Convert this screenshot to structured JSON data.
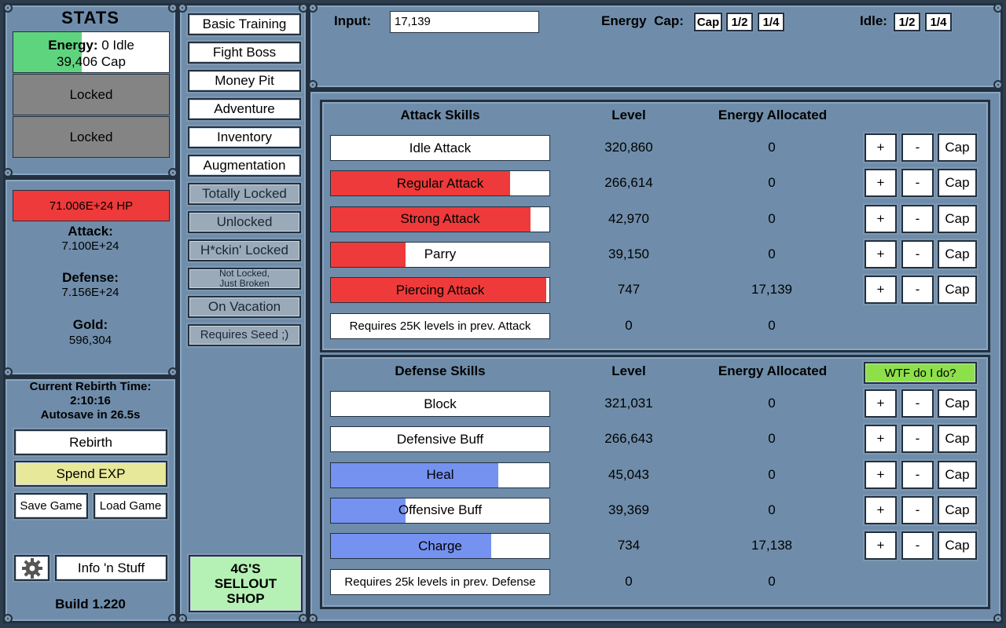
{
  "stats": {
    "title": "STATS",
    "energy_label": "Energy:",
    "energy_idle": "0 Idle",
    "energy_cap": "39,406 Cap",
    "energy_fill": 0.44,
    "slot2": "Locked",
    "slot3": "Locked"
  },
  "hp_bar": "71.006E+24 HP",
  "attack_label": "Attack:",
  "attack_value": "7.100E+24",
  "defense_label": "Defense:",
  "defense_value": "7.156E+24",
  "gold_label": "Gold:",
  "gold_value": "596,304",
  "rebirth": {
    "time_label": "Current Rebirth Time:",
    "time_value": "2:10:16",
    "autosave": "Autosave in 26.5s",
    "rebirth_btn": "Rebirth",
    "spend_exp_btn": "Spend EXP",
    "save_btn": "Save Game",
    "load_btn": "Load Game",
    "info_btn": "Info 'n Stuff",
    "build": "Build 1.220"
  },
  "nav": {
    "items": [
      "Basic Training",
      "Fight Boss",
      "Money Pit",
      "Adventure",
      "Inventory",
      "Augmentation"
    ],
    "locked": [
      "Totally Locked",
      "Unlocked",
      "H*ckin' Locked",
      "Not Locked,\nJust Broken",
      "On Vacation",
      "Requires Seed ;)"
    ],
    "shop": "4G'S\nSELLOUT\nSHOP"
  },
  "topbar": {
    "input_label": "Input:",
    "input_value": "17,139",
    "energy_label": "Energy",
    "cap_label": "Cap:",
    "cap_btn": "Cap",
    "half_btn": "1/2",
    "quarter_btn": "1/4",
    "idle_label": "Idle:",
    "idle_half_btn": "1/2",
    "idle_quarter_btn": "1/4"
  },
  "attack": {
    "header_skills": "Attack Skills",
    "header_level": "Level",
    "header_energy": "Energy Allocated",
    "rows": [
      {
        "name": "Idle Attack",
        "level": "320,860",
        "energy": "0",
        "fill": 0.0
      },
      {
        "name": "Regular Attack",
        "level": "266,614",
        "energy": "0",
        "fill": 0.82
      },
      {
        "name": "Strong Attack",
        "level": "42,970",
        "energy": "0",
        "fill": 0.915
      },
      {
        "name": "Parry",
        "level": "39,150",
        "energy": "0",
        "fill": 0.34
      },
      {
        "name": "Piercing Attack",
        "level": "747",
        "energy": "17,139",
        "fill": 0.985
      }
    ],
    "req": {
      "name": "Requires 25K levels in prev. Attack",
      "level": "0",
      "energy": "0"
    }
  },
  "defense": {
    "header_skills": "Defense Skills",
    "header_level": "Level",
    "header_energy": "Energy Allocated",
    "wtf_btn": "WTF do I do?",
    "rows": [
      {
        "name": "Block",
        "level": "321,031",
        "energy": "0",
        "fill": 0.0
      },
      {
        "name": "Defensive Buff",
        "level": "266,643",
        "energy": "0",
        "fill": 0.0
      },
      {
        "name": "Heal",
        "level": "45,043",
        "energy": "0",
        "fill": 0.765
      },
      {
        "name": "Offensive Buff",
        "level": "39,369",
        "energy": "0",
        "fill": 0.34
      },
      {
        "name": "Charge",
        "level": "734",
        "energy": "17,138",
        "fill": 0.735
      }
    ],
    "req": {
      "name": "Requires 25k levels in prev. Defense",
      "level": "0",
      "energy": "0"
    }
  },
  "controls": {
    "plus": "+",
    "minus": "-",
    "cap": "Cap"
  },
  "colors": {
    "attack_fill": "#ee3a3a",
    "defense_fill": "#7592f0",
    "energy_fill": "#5fd47e",
    "hp_fill": "#ee3a3a",
    "locked_slot": "#848484",
    "spend_exp": "#e8e89a",
    "wtf": "#8ee04a",
    "shop": "#b5f0b5"
  },
  "icons": {
    "settings": "gear-icon"
  }
}
